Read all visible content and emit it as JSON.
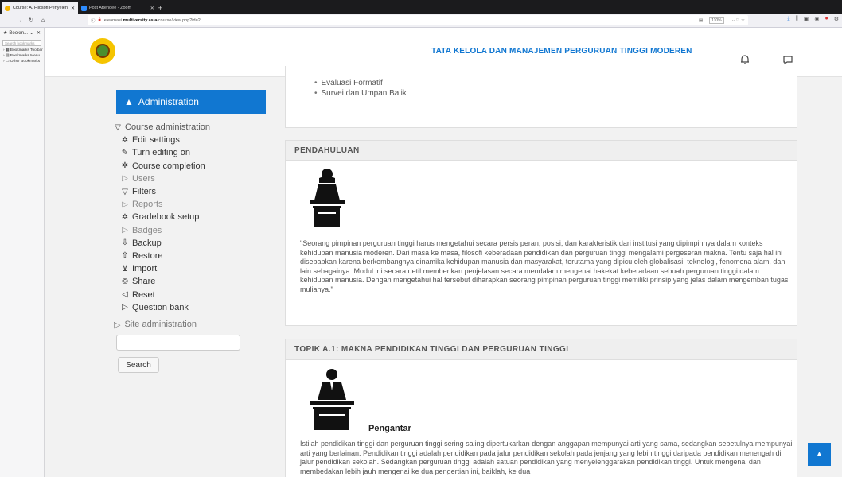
{
  "browser": {
    "tabs": [
      {
        "label": "Course: A. Filosofi Penyelenggara",
        "active": true
      },
      {
        "label": "Post Attendee - Zoom",
        "active": false
      }
    ],
    "url_prefix": "elearnasi.",
    "url_host": "multiversity.asia",
    "url_path": "/course/view.php?id=2",
    "zoom": "110%",
    "menu_dots": "··· ♡ ☆"
  },
  "bookmarks": {
    "title": "Bookm...",
    "search_placeholder": "Search bookmarks",
    "items": [
      "Bookmarks Toolbar",
      "Bookmarks Menu",
      "Other Bookmarks"
    ]
  },
  "header": {
    "site_title": "TATA KELOLA DAN MANAJEMEN PERGURUAN TINGGI MODEREN",
    "icons": [
      "bell-icon",
      "message-icon"
    ]
  },
  "admin": {
    "block_title": "Administration",
    "collapse": "–",
    "course_admin": "Course administration",
    "items": [
      {
        "label": "Edit settings",
        "icon": "gear-icon",
        "muted": false
      },
      {
        "label": "Turn editing on",
        "icon": "pencil-icon",
        "muted": false
      },
      {
        "label": "Course completion",
        "icon": "gear-icon",
        "muted": false
      },
      {
        "label": "Users",
        "icon": "caret-right-icon",
        "muted": true
      },
      {
        "label": "Filters",
        "icon": "filter-icon",
        "muted": false
      },
      {
        "label": "Reports",
        "icon": "caret-right-icon",
        "muted": true
      },
      {
        "label": "Gradebook setup",
        "icon": "gear-icon",
        "muted": false
      },
      {
        "label": "Badges",
        "icon": "caret-right-icon",
        "muted": true
      },
      {
        "label": "Backup",
        "icon": "backup-icon",
        "muted": false
      },
      {
        "label": "Restore",
        "icon": "restore-icon",
        "muted": false
      },
      {
        "label": "Import",
        "icon": "import-icon",
        "muted": false
      },
      {
        "label": "Share",
        "icon": "share-icon",
        "muted": false
      },
      {
        "label": "Reset",
        "icon": "reset-icon",
        "muted": false
      },
      {
        "label": "Question bank",
        "icon": "caret-right-icon",
        "muted": false
      }
    ],
    "site_admin": "Site administration",
    "search_button": "Search"
  },
  "content": {
    "bullets": [
      "Evaluasi Formatif",
      "Survei dan Umpan Balik"
    ],
    "section1_title": "PENDAHULUAN",
    "section1_text": "\"Seorang pimpinan perguruan tinggi harus mengetahui secara persis peran, posisi, dan karakteristik dari institusi yang dipimpinnya dalam konteks kehidupan manusia moderen. Dari masa ke masa, filosofi keberadaan pendidikan dan perguruan tinggi mengalami pergeseran makna. Tentu saja hal ini disebabkan karena berkembangnya dinamika kehidupan manusia dan masyarakat, terutama yang dipicu oleh globalisasi, teknologi, fenomena alam, dan lain sebagainya. Modul ini secara detil memberikan penjelasan secara mendalam mengenai hakekat keberadaan sebuah perguruan tinggi dalam kehidupan manusia. Dengan mengetahui hal tersebut diharapkan seorang pimpinan perguruan tinggi memiliki prinsip yang jelas dalam mengemban tugas mulianya.\"",
    "section2_title": "TOPIK A.1: MAKNA PENDIDIKAN TINGGI DAN PERGURUAN TINGGI",
    "section2_subhead": "Pengantar",
    "section2_text": "Istilah pendidikan tinggi dan perguruan tinggi sering saling dipertukarkan dengan anggapan mempunyai arti yang sama, sedangkan sebetulnya mempunyai arti yang berlainan. Pendidikan tinggi adalah pendidikan pada jalur pendidikan sekolah pada jenjang yang lebih tinggi daripada pendidikan menengah di jalur pendidikan sekolah. Sedangkan perguruan tinggi adalah satuan pendidikan yang menyelenggarakan pendidikan tinggi. Untuk mengenal dan membedakan lebih jauh mengenai ke dua pengertian ini, baiklah, ke dua"
  },
  "colors": {
    "brand": "#1177d1"
  }
}
